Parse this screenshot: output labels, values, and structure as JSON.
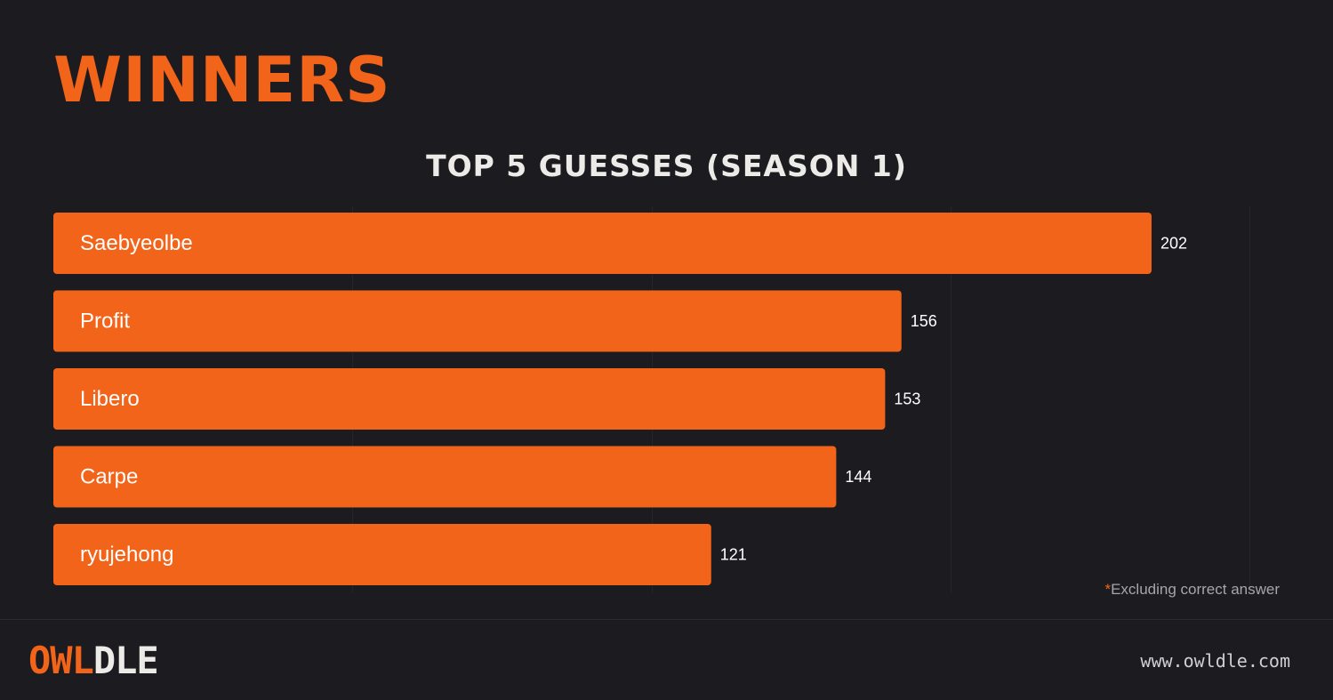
{
  "heading": "WINNERS",
  "chart_data": {
    "type": "bar",
    "orientation": "horizontal",
    "title": "TOP 5 GUESSES (SEASON 1)",
    "categories": [
      "Saebyeolbe",
      "Profit",
      "Libero",
      "Carpe",
      "ryujehong"
    ],
    "values": [
      202,
      156,
      153,
      144,
      121
    ],
    "xlim": [
      0,
      220
    ],
    "grid": true,
    "bar_color": "#f26419",
    "grid_color": "#26252a"
  },
  "footnote": {
    "mark": "*",
    "text": "Excluding correct answer"
  },
  "footer": {
    "logo_part1": "OWL",
    "logo_part2": "DLE",
    "url": "www.owldle.com"
  },
  "colors": {
    "background": "#1c1b1f",
    "accent": "#f26419",
    "text": "#ecebe7"
  }
}
